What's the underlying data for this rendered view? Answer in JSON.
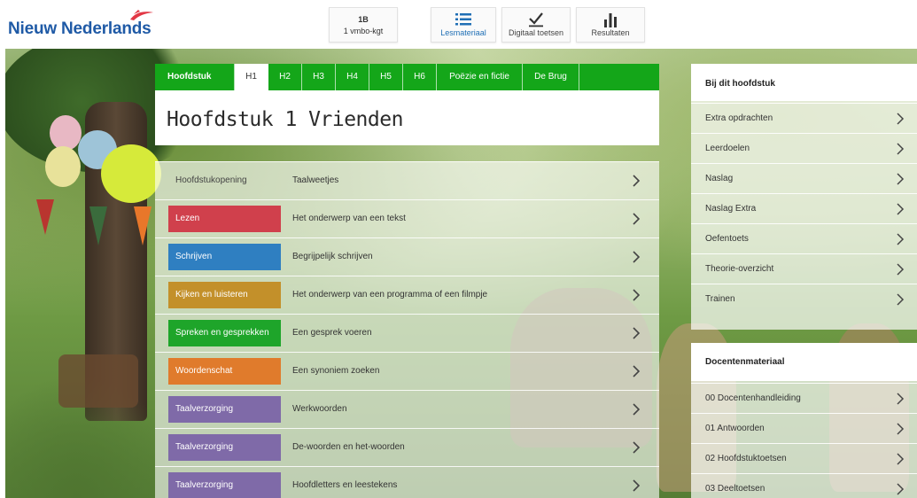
{
  "header": {
    "logo_text": "Nieuw Nederlands",
    "level_button": {
      "title": "1B",
      "subtitle": "1 vmbo-kgt"
    },
    "nav": [
      {
        "label": "Lesmateriaal",
        "icon": "list-icon",
        "active": true
      },
      {
        "label": "Digitaal toetsen",
        "icon": "checkmark-icon"
      },
      {
        "label": "Resultaten",
        "icon": "bar-chart-icon"
      }
    ]
  },
  "tabs": {
    "first": "Hoofdstuk",
    "items": [
      "H1",
      "H2",
      "H3",
      "H4",
      "H5",
      "H6",
      "Poëzie en fictie",
      "De Brug"
    ],
    "active_index": 0
  },
  "chapter": {
    "title": "Hoofdstuk 1 Vrienden"
  },
  "rows": [
    {
      "label": "Hoofdstukopening",
      "desc": "Taalweetjes",
      "color": ""
    },
    {
      "label": "Lezen",
      "desc": "Het onderwerp van een tekst",
      "color": "#d0404c"
    },
    {
      "label": "Schrijven",
      "desc": "Begrijpelijk schrijven",
      "color": "#2f7fc1"
    },
    {
      "label": "Kijken en luisteren",
      "desc": "Het onderwerp van een programma of een filmpje",
      "color": "#c3902a"
    },
    {
      "label": "Spreken en gesprekken",
      "desc": "Een gesprek voeren",
      "color": "#1ea52a"
    },
    {
      "label": "Woordenschat",
      "desc": "Een synoniem zoeken",
      "color": "#e07b2c"
    },
    {
      "label": "Taalverzorging",
      "desc": "Werkwoorden",
      "color": "#7f6aa8"
    },
    {
      "label": "Taalverzorging",
      "desc": "De-woorden en het-woorden",
      "color": "#7f6aa8"
    },
    {
      "label": "Taalverzorging",
      "desc": "Hoofdletters en leestekens",
      "color": "#7f6aa8"
    }
  ],
  "sidebar": {
    "chapter_header": "Bij dit hoofdstuk",
    "chapter_items": [
      "Extra opdrachten",
      "Leerdoelen",
      "Naslag",
      "Naslag Extra",
      "Oefentoets",
      "Theorie-overzicht",
      "Trainen"
    ],
    "teacher_header": "Docentenmateriaal",
    "teacher_items": [
      "00 Docentenhandleiding",
      "01 Antwoorden",
      "02 Hoofdstuktoetsen",
      "03 Deeltoetsen"
    ]
  },
  "colors": {
    "tab_green": "#14a619",
    "brand_blue": "#1f5aa6",
    "brand_red": "#e23744"
  }
}
